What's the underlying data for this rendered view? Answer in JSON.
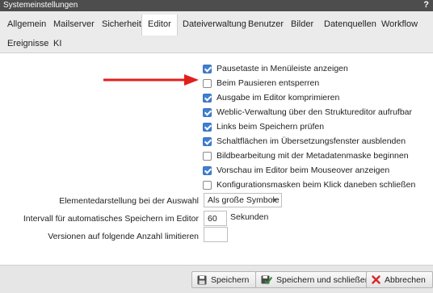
{
  "window": {
    "title": "Systemeinstellungen",
    "help": "?"
  },
  "tabs": [
    {
      "label": "Allgemein"
    },
    {
      "label": "Mailserver"
    },
    {
      "label": "Sicherheit"
    },
    {
      "label": "Editor",
      "active": true
    },
    {
      "label": "Dateiverwaltung"
    },
    {
      "label": "Benutzer"
    },
    {
      "label": "Bilder"
    },
    {
      "label": "Datenquellen"
    },
    {
      "label": "Workflow"
    },
    {
      "label": "Ereignisse"
    },
    {
      "label": "KI"
    }
  ],
  "options": [
    {
      "label": "Pausetaste in Menüleiste anzeigen",
      "checked": true
    },
    {
      "label": "Beim Pausieren entsperren",
      "checked": false
    },
    {
      "label": "Ausgabe im Editor komprimieren",
      "checked": true
    },
    {
      "label": "Weblic-Verwaltung über den Struktureditor aufrufbar",
      "checked": true
    },
    {
      "label": "Links beim Speichern prüfen",
      "checked": true
    },
    {
      "label": "Schaltflächen im Übersetzungsfenster ausblenden",
      "checked": true
    },
    {
      "label": "Bildbearbeitung mit der Metadatenmaske beginnen",
      "checked": false
    },
    {
      "label": "Vorschau im Editor beim Mouseover anzeigen",
      "checked": true
    },
    {
      "label": "Konfigurationsmasken beim Klick daneben schließen",
      "checked": false
    }
  ],
  "fields": {
    "element_display": {
      "label": "Elementedarstellung bei der Auswahl",
      "value": "Als große Symbole"
    },
    "autosave": {
      "label": "Intervall für automatisches Speichern im Editor",
      "value": "60",
      "unit": "Sekunden"
    },
    "versions": {
      "label": "Versionen auf folgende Anzahl limitieren",
      "value": ""
    }
  },
  "buttons": {
    "save": "Speichern",
    "save_close": "Speichern und schließen",
    "cancel": "Abbrechen"
  },
  "colors": {
    "accent": "#3f7fd0",
    "arrow": "#e0201c",
    "cancel_icon": "#d9262c",
    "save_close_icon": "#3a8a3a"
  }
}
